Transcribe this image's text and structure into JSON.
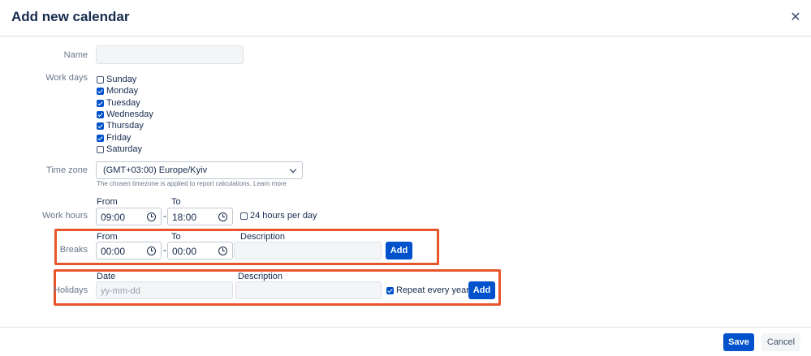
{
  "dialog": {
    "title": "Add new calendar",
    "close_icon": "close-icon"
  },
  "name": {
    "label": "Name",
    "value": ""
  },
  "work_days": {
    "label": "Work days",
    "days": [
      {
        "label": "Sunday",
        "checked": false
      },
      {
        "label": "Monday",
        "checked": true
      },
      {
        "label": "Tuesday",
        "checked": true
      },
      {
        "label": "Wednesday",
        "checked": true
      },
      {
        "label": "Thursday",
        "checked": true
      },
      {
        "label": "Friday",
        "checked": true
      },
      {
        "label": "Saturday",
        "checked": false
      }
    ]
  },
  "time_zone": {
    "label": "Time zone",
    "selected": "(GMT+03:00) Europe/Kyiv",
    "help": "The chosen timezone is applied to report calculations. Learn more"
  },
  "work_hours": {
    "label": "Work hours",
    "from_label": "From",
    "to_label": "To",
    "from": "09:00",
    "separator": "-",
    "to": "18:00",
    "all_day_label": "24 hours per day",
    "all_day_checked": false
  },
  "breaks": {
    "label": "Breaks",
    "from_label": "From",
    "to_label": "To",
    "description_label": "Description",
    "from": "00:00",
    "separator": "-",
    "to": "00:00",
    "description": "",
    "add_label": "Add"
  },
  "holidays": {
    "label": "Holidays",
    "date_label": "Date",
    "description_label": "Description",
    "date_placeholder": "yy-mm-dd",
    "description": "",
    "repeat_label": "Repeat every year",
    "repeat_checked": true,
    "add_label": "Add"
  },
  "footer": {
    "save_label": "Save",
    "cancel_label": "Cancel"
  },
  "colors": {
    "primary": "#0052cc",
    "highlight": "#e8552b",
    "text": "#172b4d",
    "muted": "#6b778c"
  }
}
